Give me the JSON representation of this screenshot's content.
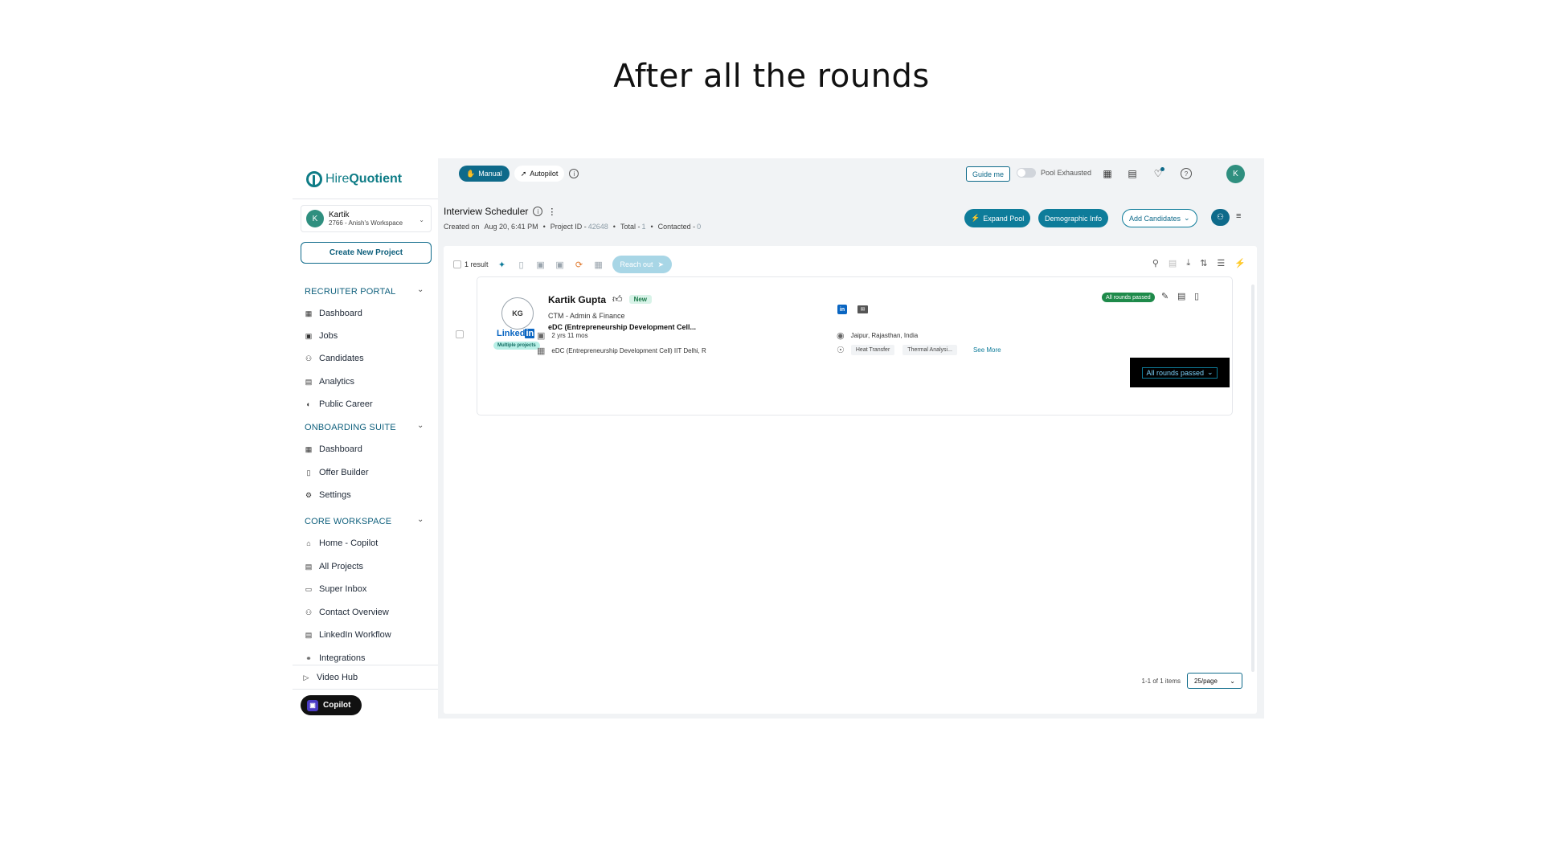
{
  "slide_title": "After all the rounds",
  "app": {
    "logo_prefix": "Hire",
    "logo_suffix": "Quotient"
  },
  "workspace": {
    "avatar": "K",
    "name": "Kartik",
    "detail": "2766 - Anish's Workspace"
  },
  "sidebar": {
    "create_button": "Create New Project",
    "sections": [
      {
        "title": "RECRUITER PORTAL",
        "items": [
          "Dashboard",
          "Jobs",
          "Candidates",
          "Analytics",
          "Public Career"
        ]
      },
      {
        "title": "ONBOARDING SUITE",
        "items": [
          "Dashboard",
          "Offer Builder",
          "Settings"
        ]
      },
      {
        "title": "CORE WORKSPACE",
        "items": [
          "Home - Copilot",
          "All Projects",
          "Super Inbox",
          "Contact Overview",
          "LinkedIn Workflow",
          "Integrations",
          "Video Hub"
        ]
      }
    ],
    "copilot_label": "Copilot"
  },
  "topbar": {
    "manual_label": "Manual",
    "autopilot_label": "Autopilot",
    "guide_label": "Guide me",
    "pool_label": "Pool Exhausted",
    "user_avatar": "K"
  },
  "header": {
    "title": "Interview Scheduler",
    "created_label": "Created on",
    "created_value": "Aug 20, 6:41 PM",
    "project_label": "Project ID -",
    "project_value": "42648",
    "total_label": "Total -",
    "total_value": "1",
    "contacted_label": "Contacted -",
    "contacted_value": "0",
    "expand_pool": "Expand Pool",
    "demographic": "Demographic Info",
    "add_candidates": "Add Candidates"
  },
  "toolbar": {
    "result_count": "1 result",
    "reach_out": "Reach out"
  },
  "candidate": {
    "initials": "KG",
    "linkedin_word": "Linked",
    "linkedin_in": "in",
    "multi_projects": "Multiple projects",
    "name": "Kartik Gupta",
    "badge": "New",
    "role": "CTM - Admin & Finance",
    "org": "eDC (Entrepreneurship Development Cell...",
    "experience": "2 yrs 11 mos",
    "education": "eDC (Entrepreneurship Development Cell) IIT Delhi, R",
    "location": "Jaipur, Rajasthan, India",
    "skills": [
      "Heat Transfer",
      "Thermal Analysi..."
    ],
    "see_more": "See More",
    "status_badge": "All rounds passed",
    "status_select": "All rounds passed"
  },
  "pagination": {
    "summary": "1-1 of 1 items",
    "page_size": "25/page"
  },
  "colors": {
    "brand": "#0e6a8a",
    "success": "#1e8a4a",
    "linkedin": "#0a66c2"
  }
}
